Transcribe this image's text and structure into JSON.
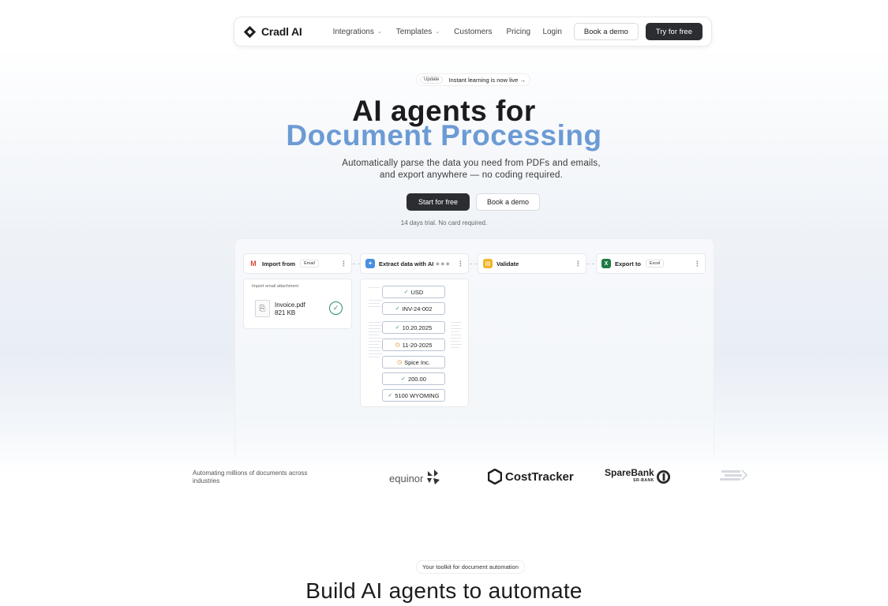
{
  "nav": {
    "brand": "Cradl AI",
    "links": [
      {
        "label": "Integrations",
        "dropdown": true
      },
      {
        "label": "Templates",
        "dropdown": true
      },
      {
        "label": "Customers",
        "dropdown": false
      },
      {
        "label": "Pricing",
        "dropdown": false
      }
    ],
    "login": "Login",
    "book_demo": "Book a demo",
    "try_free": "Try for free"
  },
  "hero": {
    "update_tag": "Update",
    "update_text": "Instant learning is now live →",
    "title_line1": "AI agents for",
    "title_line2": "Document Processing",
    "subtitle": "Automatically parse the data you need from PDFs and emails, and export anywhere — no coding required.",
    "cta_primary": "Start for free",
    "cta_secondary": "Book a demo",
    "trial_note": "14 days trial. No card required."
  },
  "workflow": {
    "steps": [
      {
        "label": "Import from",
        "tag": "Email",
        "icon": "gmail-icon"
      },
      {
        "label": "Extract data with AI",
        "tag": "",
        "icon": "ai-sparkle-icon"
      },
      {
        "label": "Validate",
        "tag": "",
        "icon": "validate-icon"
      },
      {
        "label": "Export to",
        "tag": "Excel",
        "icon": "excel-icon"
      }
    ],
    "import_panel": {
      "caption": "Import email attachment",
      "file_name": "Invoice.pdf",
      "file_size": "821 KB"
    },
    "extracted_fields": [
      {
        "value": "USD",
        "status": "ok"
      },
      {
        "value": "INV-24-002",
        "status": "ok"
      },
      {
        "value": "10.20.2025",
        "status": "ok"
      },
      {
        "value": "11-20-2025",
        "status": "warn"
      },
      {
        "value": "Spice Inc.",
        "status": "warn"
      },
      {
        "value": "200.00",
        "status": "ok"
      },
      {
        "value": "5100 WYOMING",
        "status": "ok"
      }
    ]
  },
  "logos": {
    "caption": "Automating millions of documents across industries",
    "brands": [
      "equinor",
      "CostTracker",
      "SpareBank",
      "SR-BANK"
    ]
  },
  "section2": {
    "pill": "Your toolkit for document automation",
    "title": "Build AI agents to automate"
  }
}
